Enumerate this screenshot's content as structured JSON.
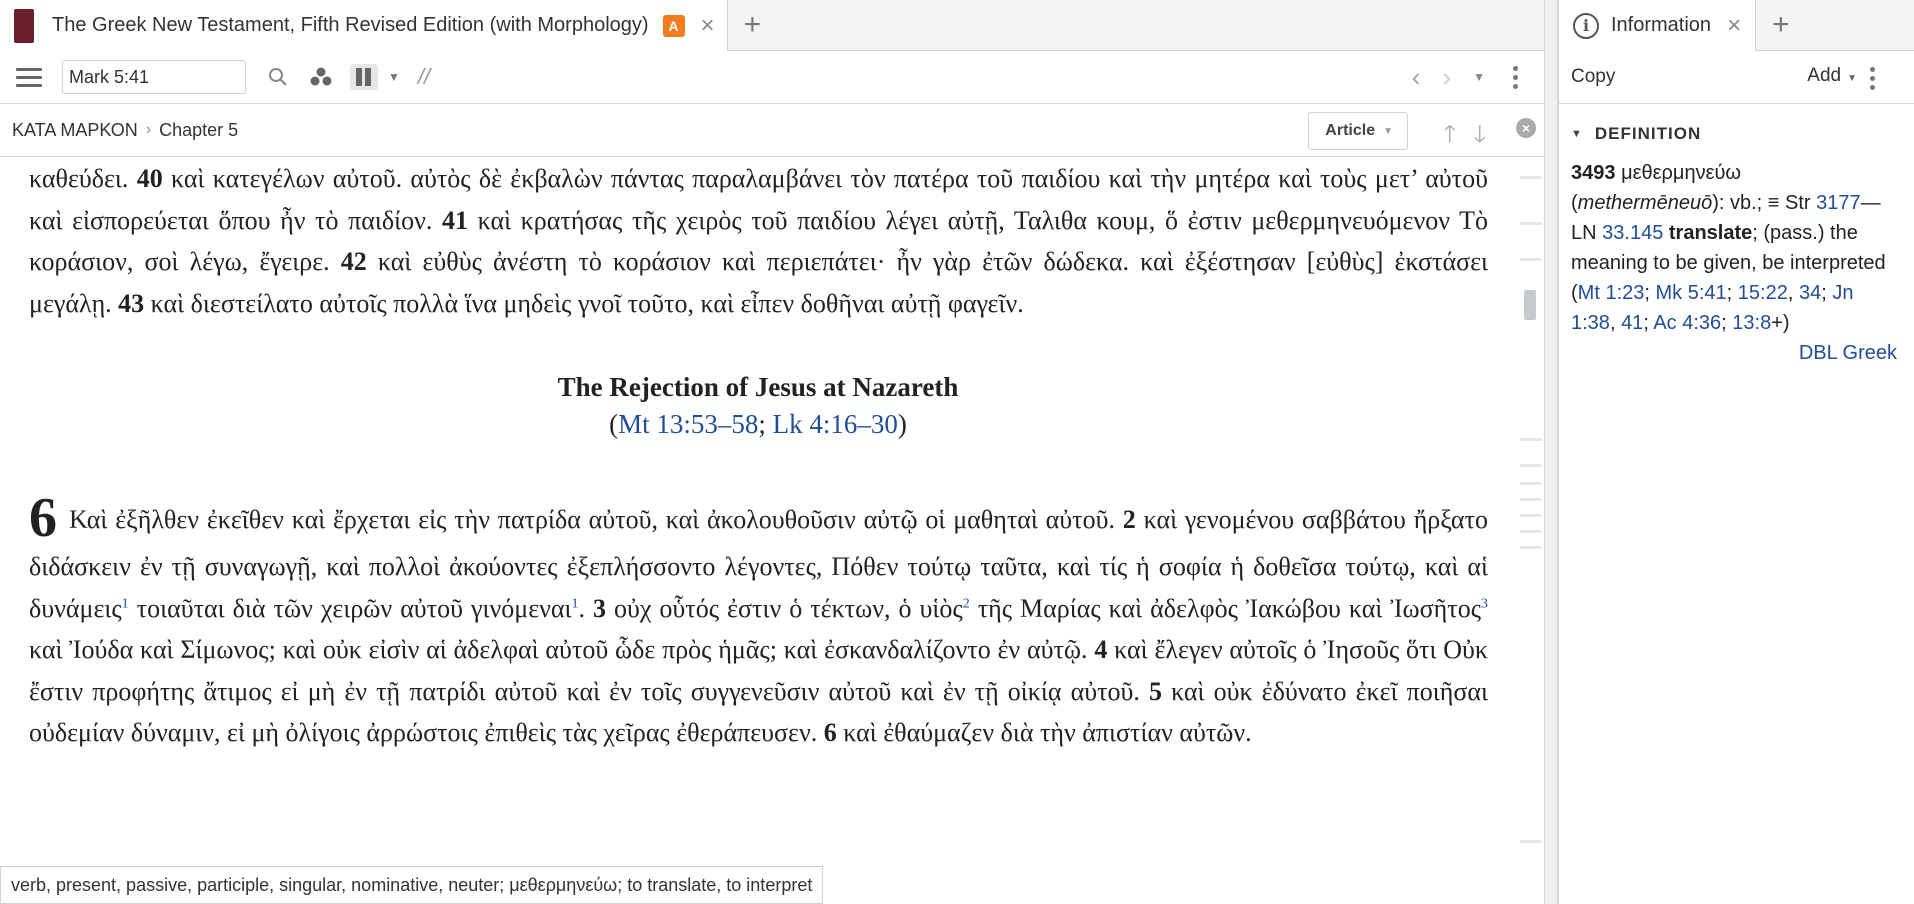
{
  "left_tab": {
    "title": "The Greek New Testament, Fifth Revised Edition (with Morphology)",
    "badge": "A"
  },
  "toolbar": {
    "reference": "Mark 5:41",
    "parallel_symbol": "//"
  },
  "breadcrumb": {
    "book": "ΚΑΤΑ ΜΑΡΚΟΝ",
    "chapter": "Chapter 5"
  },
  "view_button": "Article",
  "text": {
    "p1": {
      "a": "καθεύδει.",
      "v40": "40",
      "b": "καὶ κατεγέλων αὐτοῦ. αὐτὸς δὲ ἐκβαλὼν πάντας παραλαμβάνει τὸν πατέρα τοῦ παιδίου καὶ τὴν μητέρα καὶ τοὺς μετ’ αὐτοῦ καὶ εἰσπορεύεται ὅπου ἦν τὸ παιδίον.",
      "v41": "41",
      "c": "καὶ κρατήσας τῆς χειρὸς τοῦ παιδίου λέγει αὐτῇ, Ταλιθα κουμ, ὅ ἐστιν μεθερμηνευόμενον Τὸ κοράσιον, σοὶ λέγω, ἔγειρε.",
      "v42": "42",
      "d": "καὶ εὐθὺς ἀνέστη τὸ κοράσιον καὶ περιεπάτει· ἦν γὰρ ἐτῶν δώδεκα. καὶ ἐξέστησαν [εὐθὺς] ἐκστάσει μεγάλῃ.",
      "v43": "43",
      "e": "καὶ διεστείλατο αὐτοῖς πολλὰ ἵνα μηδεὶς γνοῖ τοῦτο, καὶ εἶπεν δοθῆναι αὐτῇ φαγεῖν."
    },
    "section_heading": "The Rejection of Jesus at Nazareth",
    "section_refs": {
      "open": "(",
      "ref1": "Mt 13:53–58",
      "sep": "; ",
      "ref2": "Lk 4:16–30",
      "close": ")"
    },
    "p2": {
      "chapter": "6",
      "a": "Καὶ ἐξῆλθεν ἐκεῖθεν καὶ ἔρχεται εἰς τὴν πατρίδα αὐτοῦ, καὶ ἀκολουθοῦσιν αὐτῷ οἱ μαθηταὶ αὐτοῦ.",
      "v2": "2",
      "b": "καὶ γενομένου σαββάτου ἤρξατο διδάσκειν ἐν τῇ συναγωγῇ, καὶ πολλοὶ ἀκούοντες ἐξεπλήσσοντο λέγοντες, Πόθεν τούτῳ ταῦτα, καὶ τίς ἡ σοφία ἡ δοθεῖσα τούτῳ, καὶ αἱ δυνάμεις",
      "fn1": "1",
      "c": "τοιαῦται διὰ τῶν χειρῶν αὐτοῦ γινόμεναι",
      "fn1b": "1",
      "d": ".",
      "v3": "3",
      "e": "οὐχ οὗτός ἐστιν ὁ τέκτων, ὁ υἱὸς",
      "fn2": "2",
      "f": "τῆς Μαρίας καὶ ἀδελφὸς Ἰακώβου καὶ Ἰωσῆτος",
      "fn3": "3",
      "g": "καὶ Ἰούδα καὶ Σίμωνος; καὶ οὐκ εἰσὶν αἱ ἀδελφαὶ αὐτοῦ ὧδε πρὸς ἡμᾶς; καὶ ἐσκανδαλίζοντο ἐν αὐτῷ.",
      "v4": "4",
      "h": "καὶ ἔλεγεν αὐτοῖς ὁ Ἰησοῦς ὅτι Οὐκ ἔστιν προφήτης ἄτιμος εἰ μὴ ἐν τῇ πατρίδι αὐτοῦ καὶ ἐν τοῖς συγγενεῦσιν αὐτοῦ καὶ ἐν τῇ οἰκίᾳ αὐτοῦ.",
      "v5": "5",
      "i": "καὶ οὐκ ἐδύνατο ἐκεῖ ποιῆσαι οὐδεμίαν δύναμιν, εἰ μὴ ὀλίγοις ἀρρώστοις ἐπιθεὶς τὰς χεῖρας ἐθεράπευσεν.",
      "v6": "6",
      "j": "καὶ ἐθαύμαζεν διὰ τὴν ἀπιστίαν αὐτῶν."
    }
  },
  "status_bar": "verb, present, passive, participle, singular, nominative, neuter; μεθερμηνεύω; to translate, to interpret",
  "info_panel": {
    "tab_title": "Information",
    "copy_label": "Copy",
    "add_label": "Add",
    "section_heading": "DEFINITION",
    "def": {
      "number": "3493",
      "lemma": "μεθερμηνεύω",
      "translit_open": "(",
      "translit": "methermēneuō",
      "after_translit": "): vb.; ≡ Str",
      "strongs": "3177",
      "ln_prefix": "—LN",
      "ln": "33.145",
      "gloss": "translate",
      "semicolon": ";",
      "desc": "(pass.) the meaning to be given, be interpreted (",
      "r1": "Mt 1:23",
      "r2": "Mk 5:41",
      "r3": "15:22",
      "r4": "34",
      "r5": "Jn 1:38",
      "r6": "41",
      "r7": "Ac 4:36",
      "r8": "13:8",
      "end": "+)",
      "source": "DBL Greek"
    }
  },
  "colors": {
    "link": "#1f4e96",
    "badge": "#f47b20",
    "book_cover": "#6b1f2a"
  }
}
